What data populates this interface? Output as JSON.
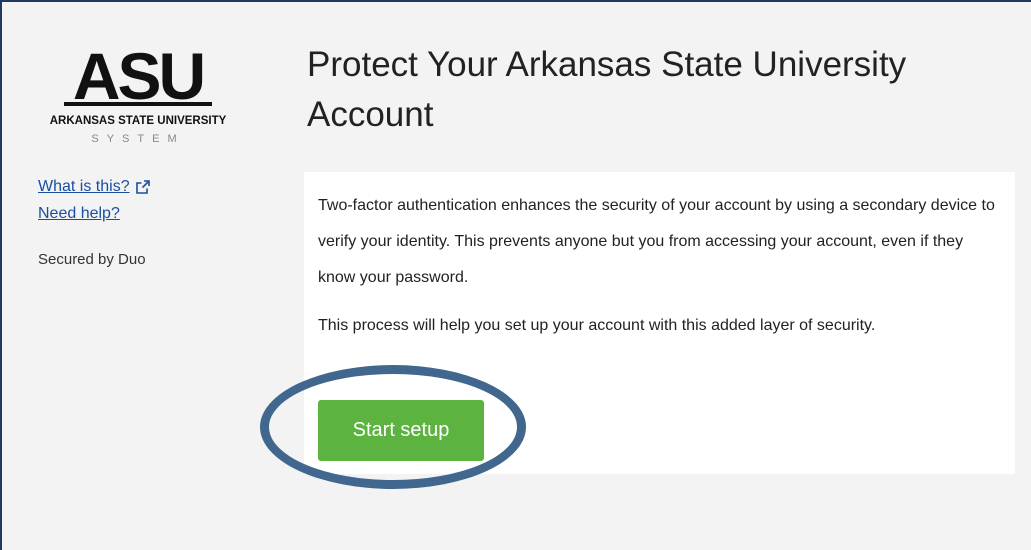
{
  "brand": {
    "logo_text": "ASU",
    "logo_subtitle": "ARKANSAS STATE UNIVERSITY",
    "logo_system": "SYSTEM"
  },
  "sidebar": {
    "what_is_this": "What is this?",
    "need_help": "Need help?",
    "secured_by": "Secured by Duo"
  },
  "main": {
    "title": "Protect Your Arkansas State University Account",
    "paragraph1": "Two-factor authentication enhances the security of your account by using a secondary device to verify your identity. This prevents anyone but you from accessing your account, even if they know your password.",
    "paragraph2": "This process will help you set up your account with this added layer of security.",
    "start_button": "Start setup"
  },
  "colors": {
    "accent_button": "#5db340",
    "link": "#1a4fa0",
    "annotation_circle": "#41678f",
    "frame_border": "#1f3864"
  },
  "icons": {
    "external_link": "external-link-icon"
  }
}
